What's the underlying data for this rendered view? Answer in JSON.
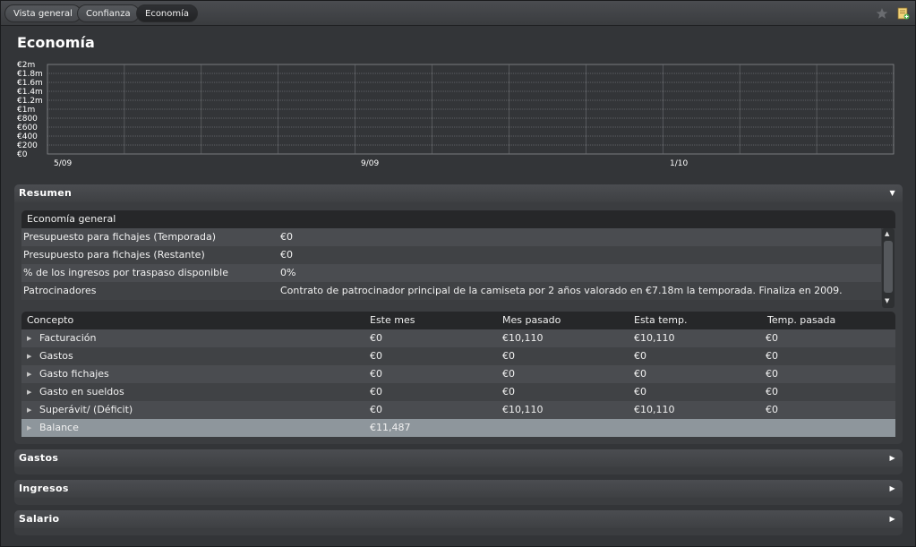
{
  "tabs": [
    {
      "label": "Vista general"
    },
    {
      "label": "Confianza"
    },
    {
      "label": "Economía"
    }
  ],
  "toolbar_icons": [
    "star-icon",
    "notes-add-icon"
  ],
  "page": {
    "title": "Economía"
  },
  "chart_data": {
    "type": "line",
    "title": "",
    "y_ticks": [
      "€0",
      "€200",
      "€400",
      "€600",
      "€800",
      "€1m",
      "€1.2m",
      "€1.4m",
      "€1.6m",
      "€1.8m",
      "€2m"
    ],
    "x_ticks": [
      "5/09",
      "9/09",
      "1/10"
    ],
    "ylim": [
      0,
      2000000
    ],
    "grid": true,
    "series": []
  },
  "resumen": {
    "label": "Resumen",
    "general": {
      "header": "Economía general",
      "rows": [
        {
          "label": "Presupuesto para fichajes (Temporada)",
          "value": "€0"
        },
        {
          "label": "Presupuesto para fichajes (Restante)",
          "value": "€0"
        },
        {
          "label": "% de los ingresos por traspaso disponible",
          "value": "0%"
        },
        {
          "label": "Patrocinadores",
          "value": "Contrato de patrocinador principal de la camiseta por 2 años valorado en €7.18m la temporada. Finaliza en 2009."
        }
      ]
    },
    "conceptos": {
      "headers": [
        "Concepto",
        "Este mes",
        "Mes pasado",
        "Esta temp.",
        "Temp. pasada"
      ],
      "rows": [
        {
          "concepto": "Facturación",
          "este_mes": "€0",
          "mes_pasado": "€10,110",
          "esta_temp": "€10,110",
          "temp_pasada": "€0"
        },
        {
          "concepto": "Gastos",
          "este_mes": "€0",
          "mes_pasado": "€0",
          "esta_temp": "€0",
          "temp_pasada": "€0"
        },
        {
          "concepto": "Gasto fichajes",
          "este_mes": "€0",
          "mes_pasado": "€0",
          "esta_temp": "€0",
          "temp_pasada": "€0"
        },
        {
          "concepto": "Gasto en sueldos",
          "este_mes": "€0",
          "mes_pasado": "€0",
          "esta_temp": "€0",
          "temp_pasada": "€0"
        },
        {
          "concepto": "Superávit/ (Déficit)",
          "este_mes": "€0",
          "mes_pasado": "€10,110",
          "esta_temp": "€10,110",
          "temp_pasada": "€0"
        },
        {
          "concepto": "Balance",
          "este_mes": "€11,487",
          "mes_pasado": "",
          "esta_temp": "",
          "temp_pasada": ""
        }
      ]
    }
  },
  "panels": [
    {
      "label": "Gastos"
    },
    {
      "label": "Ingresos"
    },
    {
      "label": "Salario"
    }
  ]
}
